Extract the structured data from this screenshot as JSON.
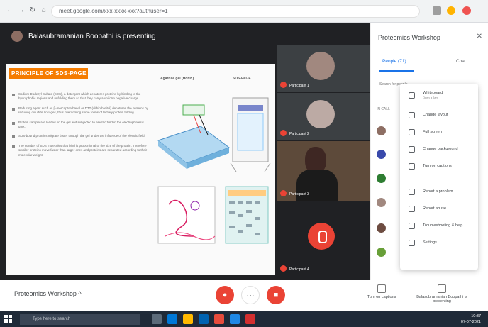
{
  "browser": {
    "url": "meet.google.com/xxx-xxxx-xxx?authuser=1",
    "icons": [
      "back-icon",
      "forward-icon",
      "reload-icon",
      "star-icon",
      "extensions-icon",
      "profile-icon"
    ]
  },
  "meeting": {
    "presenter_label": "Balasubramanian Boopathi is presenting",
    "name": "Proteomics Workshop"
  },
  "slide": {
    "title": "PRINCIPLE OF SDS-PAGE",
    "figure_labels": [
      "Agarose gel (Horiz.)",
      "SDS-PAGE"
    ],
    "bullets": [
      "Sodium Dodecyl Sulfate (SDS), a detergent which denatures proteins by binding to the hydrophobic regions and unfolding them so that they carry a uniform negative charge.",
      "Reducing agent such as β-mercaptoethanol or DTT (dithiothreitol) denatures the proteins by reducing disulfide linkages, thus overcoming some forms of tertiary protein folding.",
      "Protein sample are loaded on the gel and subjected to electric field in the electrophoresis tank.",
      "SDS-bound proteins migrate faster through the gel under the influence of the electric field.",
      "The number of SDS molecules that bind is proportional to the size of the protein. Therefore smaller proteins move faster than larger ones and proteins are separated according to their molecular weight."
    ]
  },
  "tiles": [
    {
      "name": "Participant 1"
    },
    {
      "name": "Participant 2"
    },
    {
      "name": "Participant 3"
    },
    {
      "name": "Participant 4"
    }
  ],
  "controls": {
    "mic_icon": "mic-off-icon",
    "hangup_icon": "call-end-icon",
    "camera_icon": "camera-off-icon",
    "turn_on_captions": "Turn on captions",
    "presenting_label": "Balasubramanian Boopathi is presenting"
  },
  "panel": {
    "title": "Proteomics Workshop",
    "tabs": [
      {
        "label": "People (71)"
      },
      {
        "label": "Chat"
      }
    ],
    "search_placeholder": "Search for people",
    "in_call_label": "IN CALL"
  },
  "menu": {
    "items": [
      {
        "label": "Whiteboard",
        "sub": "Open a Jam",
        "icon": "pen-icon"
      },
      {
        "label": "Change layout",
        "icon": "layout-icon"
      },
      {
        "label": "Full screen",
        "icon": "fullscreen-icon"
      },
      {
        "label": "Change background",
        "icon": "background-icon"
      },
      {
        "label": "Turn on captions",
        "icon": "captions-icon"
      },
      {
        "label": "Report a problem",
        "icon": "feedback-icon"
      },
      {
        "label": "Report abuse",
        "icon": "report-icon"
      },
      {
        "label": "Troubleshooting & help",
        "icon": "help-icon"
      },
      {
        "label": "Settings",
        "icon": "settings-icon"
      }
    ]
  },
  "taskbar": {
    "search_placeholder": "Type here to search",
    "time": "10:37",
    "date": "07-07-2021"
  },
  "colors": {
    "accent_blue": "#1a73e8",
    "danger_red": "#ea4335",
    "slide_title_orange": "#f57c00",
    "stage_dark": "#202124"
  }
}
